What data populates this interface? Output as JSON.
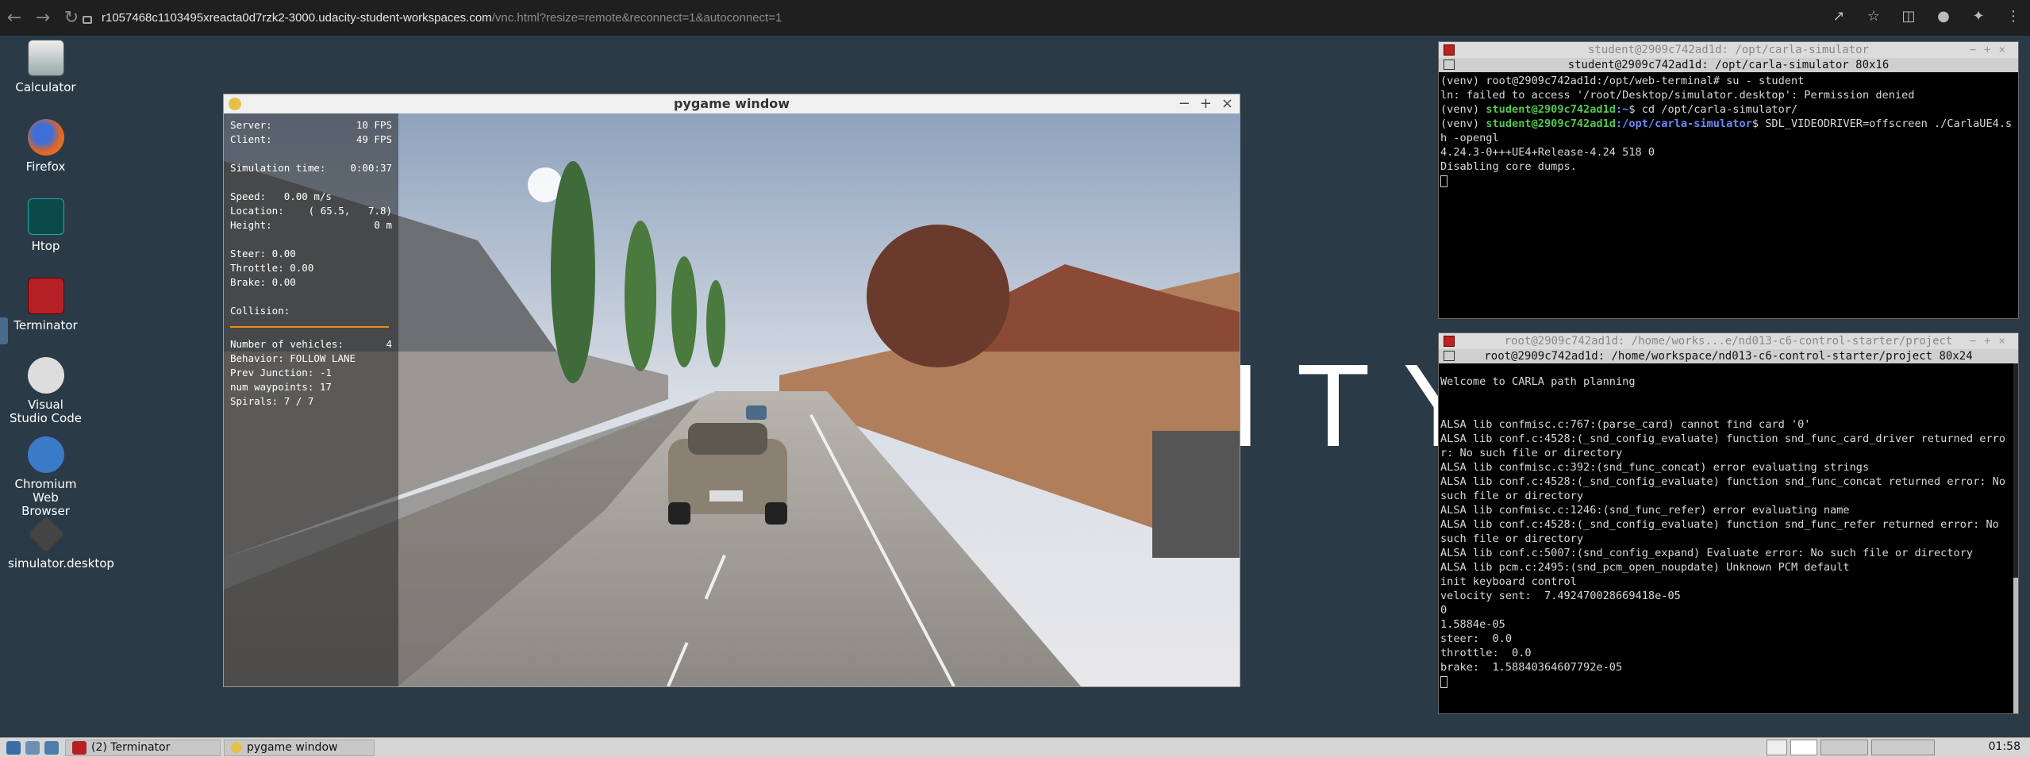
{
  "browser": {
    "url_host": "r1057468c1103495xreacta0d7rzk2-3000.udacity-student-workspaces.com",
    "url_path": "/vnc.html?resize=remote&reconnect=1&autoconnect=1"
  },
  "desktop": {
    "icons": [
      {
        "label": "Calculator"
      },
      {
        "label": "Firefox"
      },
      {
        "label": "Htop"
      },
      {
        "label": "Terminator"
      },
      {
        "label": "Visual Studio Code"
      },
      {
        "label": "Chromium Web Browser"
      },
      {
        "label": "simulator.desktop"
      }
    ],
    "background_text": "ITY"
  },
  "pygame": {
    "title": "pygame window",
    "hud": {
      "server_label": "Server:",
      "server_value": "10 FPS",
      "client_label": "Client:",
      "client_value": "49 FPS",
      "simtime_label": "Simulation time:",
      "simtime_value": "0:00:37",
      "speed": "Speed:   0.00 m/s",
      "location_label": "Location:",
      "location_value": "( 65.5,   7.8)",
      "height_label": "Height:",
      "height_value": "0 m",
      "steer": "Steer: 0.00",
      "throttle": "Throttle: 0.00",
      "brake": "Brake: 0.00",
      "collision": "Collision:",
      "vehicles_label": "Number of vehicles:",
      "vehicles_value": "4",
      "behavior": "Behavior: FOLLOW LANE",
      "prev_junction": "Prev Junction: -1",
      "waypoints": "num waypoints: 17",
      "spirals": "Spirals: 7 / 7"
    }
  },
  "term1": {
    "title": "student@2909c742ad1d: /opt/carla-simulator",
    "subtitle": "student@2909c742ad1d: /opt/carla-simulator 80x16",
    "l1": "(venv) root@2909c742ad1d:/opt/web-terminal# su - student",
    "l2": "ln: failed to access '/root/Desktop/simulator.desktop': Permission denied",
    "l3_prefix": "(venv) ",
    "l3_user": "student@2909c742ad1d",
    "l3_path": ":~",
    "l3_cmd": "$ cd /opt/carla-simulator/",
    "l4_prefix": "(venv) ",
    "l4_user": "student@2909c742ad1d",
    "l4_path": ":/opt/carla-simulator",
    "l4_cmd": "$ SDL_VIDEODRIVER=offscreen ./CarlaUE4.sh -opengl",
    "l5": "4.24.3-0+++UE4+Release-4.24 518 0",
    "l6": "Disabling core dumps."
  },
  "term2": {
    "title": "root@2909c742ad1d: /home/works...e/nd013-c6-control-starter/project",
    "subtitle": "root@2909c742ad1d: /home/workspace/nd013-c6-control-starter/project 80x24",
    "lines": [
      "Welcome to CARLA path planning",
      "",
      "",
      "ALSA lib confmisc.c:767:(parse_card) cannot find card '0'",
      "ALSA lib conf.c:4528:(_snd_config_evaluate) function snd_func_card_driver returned error: No such file or directory",
      "ALSA lib confmisc.c:392:(snd_func_concat) error evaluating strings",
      "ALSA lib conf.c:4528:(_snd_config_evaluate) function snd_func_concat returned error: No such file or directory",
      "ALSA lib confmisc.c:1246:(snd_func_refer) error evaluating name",
      "ALSA lib conf.c:4528:(_snd_config_evaluate) function snd_func_refer returned error: No such file or directory",
      "ALSA lib conf.c:5007:(snd_config_expand) Evaluate error: No such file or directory",
      "ALSA lib pcm.c:2495:(snd_pcm_open_noupdate) Unknown PCM default",
      "init keyboard control",
      "velocity sent:  7.492470028669418e-05",
      "0",
      "1.5884e-05",
      "steer:  0.0",
      "throttle:  0.0",
      "brake:  1.58840364607792e-05"
    ]
  },
  "taskbar": {
    "task1": "(2) Terminator",
    "task2": "pygame window",
    "clock": "01:58"
  }
}
